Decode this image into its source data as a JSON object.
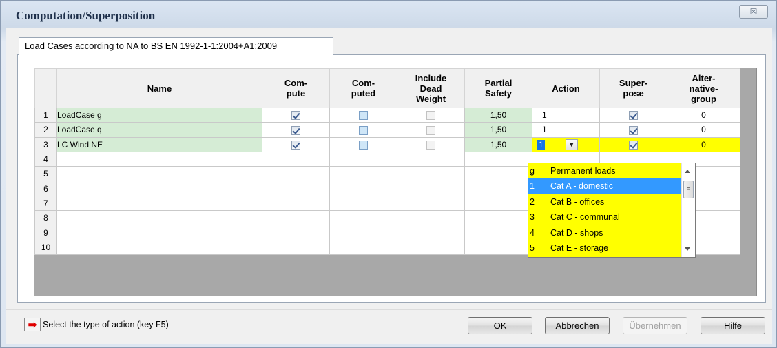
{
  "window": {
    "title": "Computation/Superposition",
    "close_glyph": "☒"
  },
  "tab": {
    "label": "Load Cases according to NA to BS EN 1992-1-1:2004+A1:2009"
  },
  "grid": {
    "headers": {
      "name": "Name",
      "compute": "Com-\npute",
      "computed": "Com-\nputed",
      "include_dead_weight": "Include\nDead\nWeight",
      "partial_safety": "Partial\nSafety",
      "action": "Action",
      "superpose": "Super-\npose",
      "alternative_group": "Alter-\nnative-\ngroup"
    },
    "rows": [
      {
        "no": "1",
        "name": "LoadCase g",
        "compute": true,
        "computed": false,
        "include_dead_weight": false,
        "partial_safety": "1,50",
        "action": "1",
        "superpose": true,
        "alternative_group": "0"
      },
      {
        "no": "2",
        "name": "LoadCase q",
        "compute": true,
        "computed": false,
        "include_dead_weight": false,
        "partial_safety": "1,50",
        "action": "1",
        "superpose": true,
        "alternative_group": "0"
      },
      {
        "no": "3",
        "name": "LC Wind NE",
        "compute": true,
        "computed": false,
        "include_dead_weight": false,
        "partial_safety": "1,50",
        "action": "1",
        "superpose": true,
        "alternative_group": "0"
      }
    ],
    "empty_rows": [
      "4",
      "5",
      "6",
      "7",
      "8",
      "9",
      "10"
    ]
  },
  "action_dropdown": {
    "items": [
      {
        "key": "g",
        "label": "Permanent loads"
      },
      {
        "key": "1",
        "label": "Cat A - domestic",
        "selected": true
      },
      {
        "key": "2",
        "label": "Cat B - offices"
      },
      {
        "key": "3",
        "label": "Cat C - communal"
      },
      {
        "key": "4",
        "label": "Cat D - shops"
      },
      {
        "key": "5",
        "label": "Cat E - storage"
      }
    ]
  },
  "hint": {
    "text": "Select the type of action (key F5)",
    "icon": "red-arrow-icon"
  },
  "buttons": {
    "ok": "OK",
    "cancel": "Abbrechen",
    "apply": "Übernehmen",
    "help": "Hilfe"
  },
  "colors": {
    "green_cell": "#d5ecd5",
    "yellow_active": "#ffff00",
    "selection_blue": "#3399ff",
    "hint_arrow": "#e00000"
  }
}
